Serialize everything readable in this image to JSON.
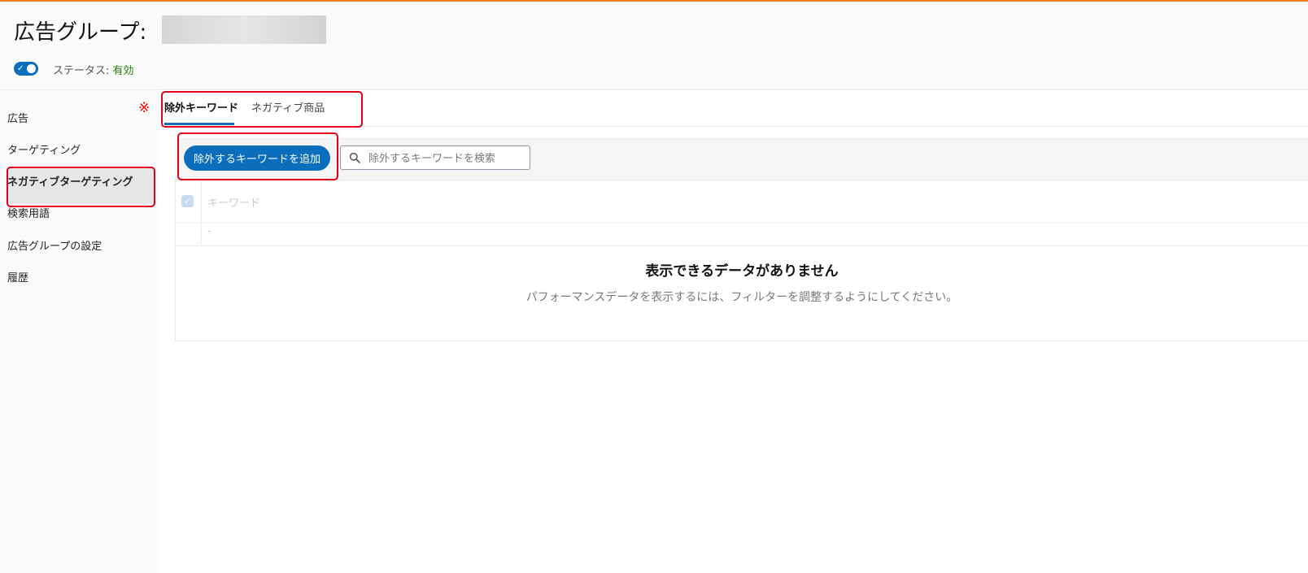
{
  "header": {
    "title": "広告グループ:",
    "status_label": "ステータス:",
    "status_value": "有効"
  },
  "sidebar": {
    "mark": "※",
    "items": [
      {
        "label": "広告"
      },
      {
        "label": "ターゲティング"
      },
      {
        "label": "ネガティブターゲティング"
      },
      {
        "label": "検索用語"
      },
      {
        "label": "広告グループの設定"
      },
      {
        "label": "履歴"
      }
    ]
  },
  "tabs": [
    {
      "label": "除外キーワード"
    },
    {
      "label": "ネガティブ商品"
    }
  ],
  "toolbar": {
    "add_button": "除外するキーワードを追加",
    "search_placeholder": "除外するキーワードを検索"
  },
  "table": {
    "column_keyword": "キーワード",
    "row_placeholder": "-",
    "empty_title": "表示できるデータがありません",
    "empty_description": "パフォーマンスデータを表示するには、フィルターを調整するようにしてください。"
  },
  "colors": {
    "accent": "#0a6ebd",
    "status_active": "#1d8102",
    "highlight": "#e4001b",
    "top_bar": "#ff7a1a"
  }
}
